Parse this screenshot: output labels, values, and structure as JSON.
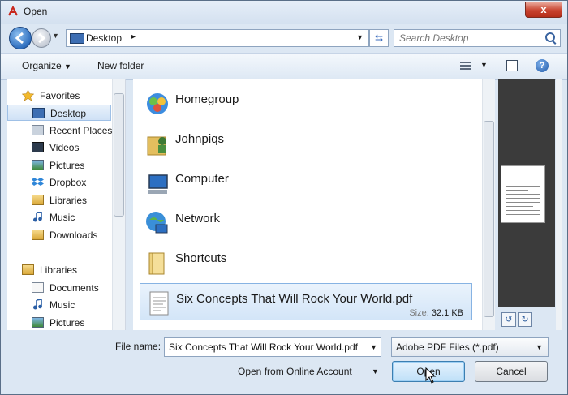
{
  "window": {
    "title": "Open",
    "close_label": "x",
    "accent_color": "#2f6fbf",
    "icons": {
      "title": "adobe-pdf-icon",
      "back": "back-arrow-icon",
      "forward": "forward-arrow-icon",
      "refresh": "refresh-icon",
      "search": "search-icon",
      "help": "help-icon"
    }
  },
  "address": {
    "location": "Desktop",
    "separator": "▸",
    "refresh_glyph": "⇆",
    "search_placeholder": "Search Desktop"
  },
  "toolbar": {
    "organize_label": "Organize",
    "new_folder_label": "New folder",
    "help_glyph": "?"
  },
  "nav": {
    "items": [
      {
        "label": "Favorites",
        "icon": "star-icon",
        "head": true
      },
      {
        "label": "Desktop",
        "icon": "desktop-icon",
        "selected": true
      },
      {
        "label": "Recent Places",
        "icon": "recent-places-icon"
      },
      {
        "label": "Videos",
        "icon": "videos-icon"
      },
      {
        "label": "Pictures",
        "icon": "pictures-icon"
      },
      {
        "label": "Dropbox",
        "icon": "dropbox-icon"
      },
      {
        "label": "Libraries",
        "icon": "libraries-icon"
      },
      {
        "label": "Music",
        "icon": "music-icon"
      },
      {
        "label": "Downloads",
        "icon": "downloads-icon"
      },
      {
        "label": "Libraries",
        "icon": "libraries-icon",
        "head": true
      },
      {
        "label": "Documents",
        "icon": "documents-icon"
      },
      {
        "label": "Music",
        "icon": "music-icon"
      },
      {
        "label": "Pictures",
        "icon": "pictures-icon"
      }
    ]
  },
  "files": {
    "items": [
      {
        "name": "Homegroup",
        "icon": "homegroup-icon"
      },
      {
        "name": "Johnpiqs",
        "icon": "user-folder-icon"
      },
      {
        "name": "Computer",
        "icon": "computer-icon"
      },
      {
        "name": "Network",
        "icon": "network-icon"
      },
      {
        "name": "Shortcuts",
        "icon": "folder-icon"
      },
      {
        "name": "Six Concepts That Will Rock Your World.pdf",
        "icon": "pdf-file-icon",
        "selected": true,
        "size_key": "Size:",
        "size_value": "32.1 KB"
      }
    ]
  },
  "bottom": {
    "file_name_label": "File name:",
    "file_name_value": "Six Concepts That Will Rock Your World.pdf",
    "file_type": "Adobe PDF Files (*.pdf)",
    "online_label": "Open from Online Account",
    "open_label": "Open",
    "cancel_label": "Cancel"
  }
}
